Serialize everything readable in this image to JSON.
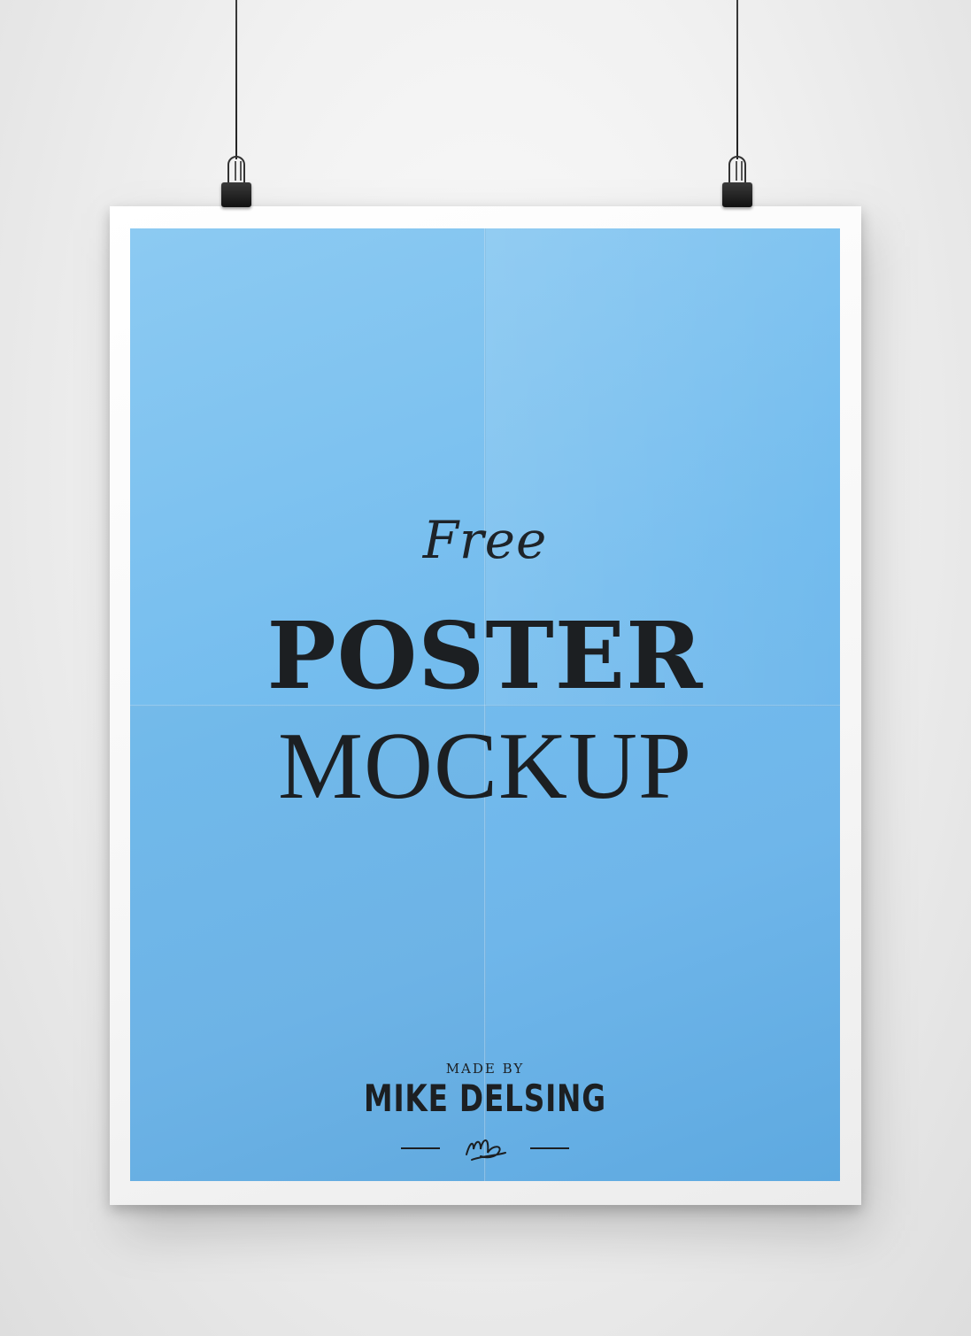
{
  "poster": {
    "free_label": "Free",
    "poster_label": "POSTER",
    "mockup_label": "MOCKUP",
    "made_by_label": "MADE BY",
    "author_name": "MIKE DELSING"
  },
  "colors": {
    "background": "#f1f1f1",
    "poster_border": "#ffffff",
    "poster_fill": "#73bcee",
    "text": "#1c1f22"
  }
}
